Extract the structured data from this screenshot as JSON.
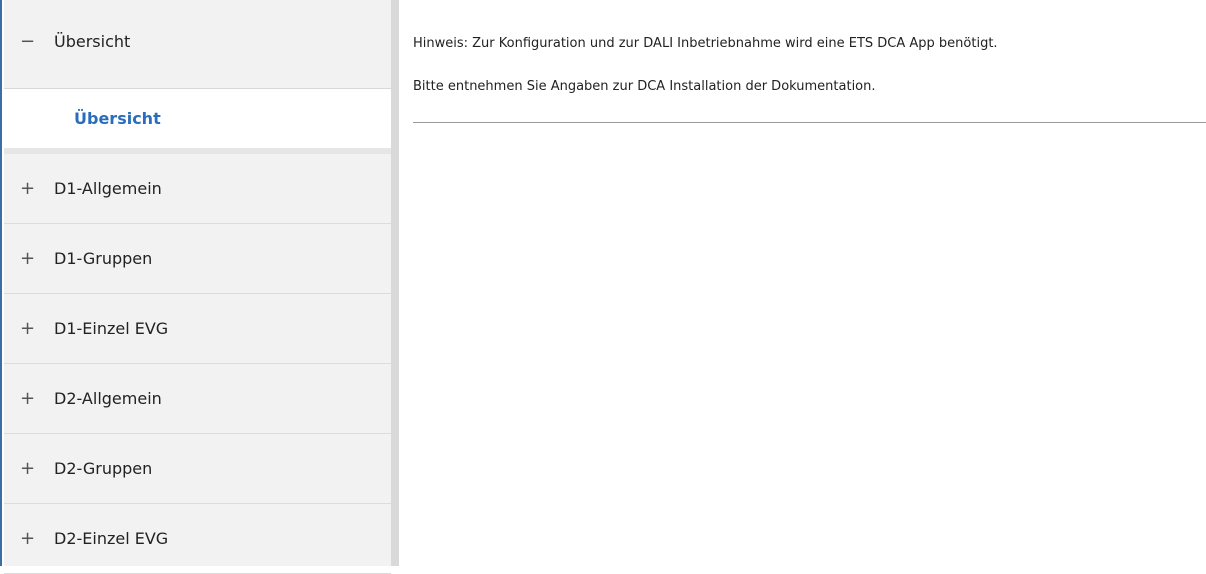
{
  "sidebar": {
    "groups": [
      {
        "sign": "−",
        "label": "Übersicht",
        "expanded": true,
        "children": [
          {
            "label": "Übersicht",
            "selected": true
          }
        ]
      },
      {
        "sign": "+",
        "label": "D1-Allgemein"
      },
      {
        "sign": "+",
        "label": "D1-Gruppen"
      },
      {
        "sign": "+",
        "label": "D1-Einzel EVG"
      },
      {
        "sign": "+",
        "label": "D2-Allgemein"
      },
      {
        "sign": "+",
        "label": "D2-Gruppen"
      },
      {
        "sign": "+",
        "label": "D2-Einzel EVG"
      }
    ]
  },
  "content": {
    "hint_line1": "Hinweis: Zur Konfiguration und zur DALI Inbetriebnahme wird eine ETS DCA App benötigt.",
    "hint_line2": "Bitte entnehmen Sie Angaben zur DCA Installation der Dokumentation."
  },
  "colors": {
    "accent": "#2a6ebb",
    "sidebar_bg": "#f2f2f2"
  }
}
